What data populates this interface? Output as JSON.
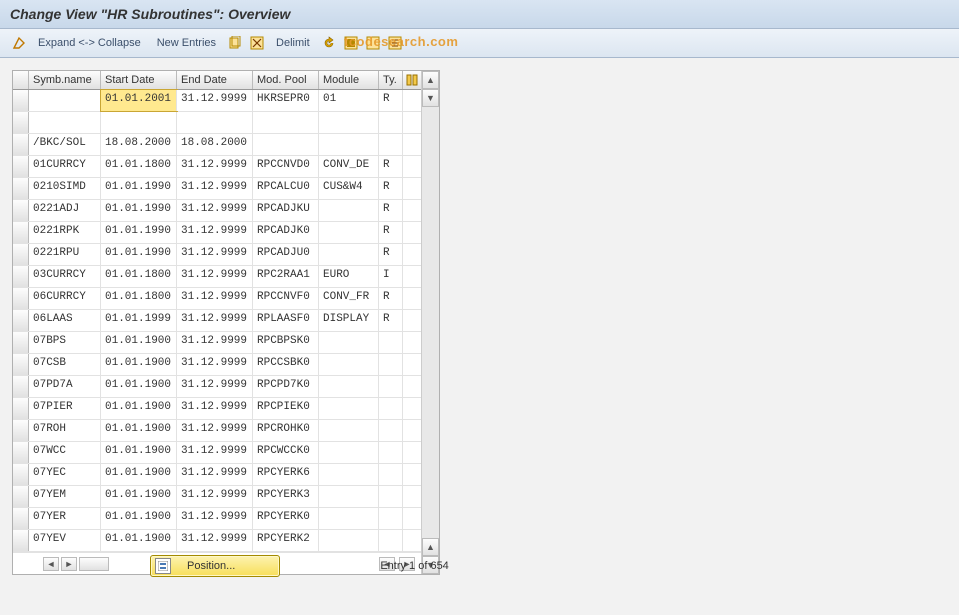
{
  "title": "Change View \"HR Subroutines\": Overview",
  "toolbar": {
    "expand_collapse": "Expand <-> Collapse",
    "new_entries": "New Entries",
    "delimit": "Delimit"
  },
  "watermark": "tcodesearch.com",
  "table": {
    "headers": {
      "symb": "Symb.name",
      "start": "Start Date",
      "end": "End Date",
      "mod": "Mod. Pool",
      "module": "Module",
      "ty": "Ty."
    },
    "rows": [
      {
        "symb": "",
        "start": "01.01.2001",
        "end": "31.12.9999",
        "mod": "HKRSEPR0",
        "module": "01",
        "ty": "R",
        "sel": true
      },
      {
        "symb": "",
        "start": "",
        "end": "",
        "mod": "",
        "module": "",
        "ty": ""
      },
      {
        "symb": "/BKC/SOL",
        "start": "18.08.2000",
        "end": "18.08.2000",
        "mod": "",
        "module": "",
        "ty": ""
      },
      {
        "symb": "01CURRCY",
        "start": "01.01.1800",
        "end": "31.12.9999",
        "mod": "RPCCNVD0",
        "module": "CONV_DE",
        "ty": "R"
      },
      {
        "symb": "0210SIMD",
        "start": "01.01.1990",
        "end": "31.12.9999",
        "mod": "RPCALCU0",
        "module": "CUS&W4",
        "ty": "R"
      },
      {
        "symb": "0221ADJ",
        "start": "01.01.1990",
        "end": "31.12.9999",
        "mod": "RPCADJKU",
        "module": "",
        "ty": "R"
      },
      {
        "symb": "0221RPK",
        "start": "01.01.1990",
        "end": "31.12.9999",
        "mod": "RPCADJK0",
        "module": "",
        "ty": "R"
      },
      {
        "symb": "0221RPU",
        "start": "01.01.1990",
        "end": "31.12.9999",
        "mod": "RPCADJU0",
        "module": "",
        "ty": "R"
      },
      {
        "symb": "03CURRCY",
        "start": "01.01.1800",
        "end": "31.12.9999",
        "mod": "RPC2RAA1",
        "module": "EURO",
        "ty": "I"
      },
      {
        "symb": "06CURRCY",
        "start": "01.01.1800",
        "end": "31.12.9999",
        "mod": "RPCCNVF0",
        "module": "CONV_FR",
        "ty": "R"
      },
      {
        "symb": "06LAAS",
        "start": "01.01.1999",
        "end": "31.12.9999",
        "mod": "RPLAASF0",
        "module": "DISPLAY",
        "ty": "R"
      },
      {
        "symb": "07BPS",
        "start": "01.01.1900",
        "end": "31.12.9999",
        "mod": "RPCBPSK0",
        "module": "",
        "ty": ""
      },
      {
        "symb": "07CSB",
        "start": "01.01.1900",
        "end": "31.12.9999",
        "mod": "RPCCSBK0",
        "module": "",
        "ty": ""
      },
      {
        "symb": "07PD7A",
        "start": "01.01.1900",
        "end": "31.12.9999",
        "mod": "RPCPD7K0",
        "module": "",
        "ty": ""
      },
      {
        "symb": "07PIER",
        "start": "01.01.1900",
        "end": "31.12.9999",
        "mod": "RPCPIEK0",
        "module": "",
        "ty": ""
      },
      {
        "symb": "07ROH",
        "start": "01.01.1900",
        "end": "31.12.9999",
        "mod": "RPCROHK0",
        "module": "",
        "ty": ""
      },
      {
        "symb": "07WCC",
        "start": "01.01.1900",
        "end": "31.12.9999",
        "mod": "RPCWCCK0",
        "module": "",
        "ty": ""
      },
      {
        "symb": "07YEC",
        "start": "01.01.1900",
        "end": "31.12.9999",
        "mod": "RPCYERK6",
        "module": "",
        "ty": ""
      },
      {
        "symb": "07YEM",
        "start": "01.01.1900",
        "end": "31.12.9999",
        "mod": "RPCYERK3",
        "module": "",
        "ty": ""
      },
      {
        "symb": "07YER",
        "start": "01.01.1900",
        "end": "31.12.9999",
        "mod": "RPCYERK0",
        "module": "",
        "ty": ""
      },
      {
        "symb": "07YEV",
        "start": "01.01.1900",
        "end": "31.12.9999",
        "mod": "RPCYERK2",
        "module": "",
        "ty": ""
      }
    ]
  },
  "footer": {
    "position": "Position...",
    "entry": "Entry 1 of 654"
  }
}
